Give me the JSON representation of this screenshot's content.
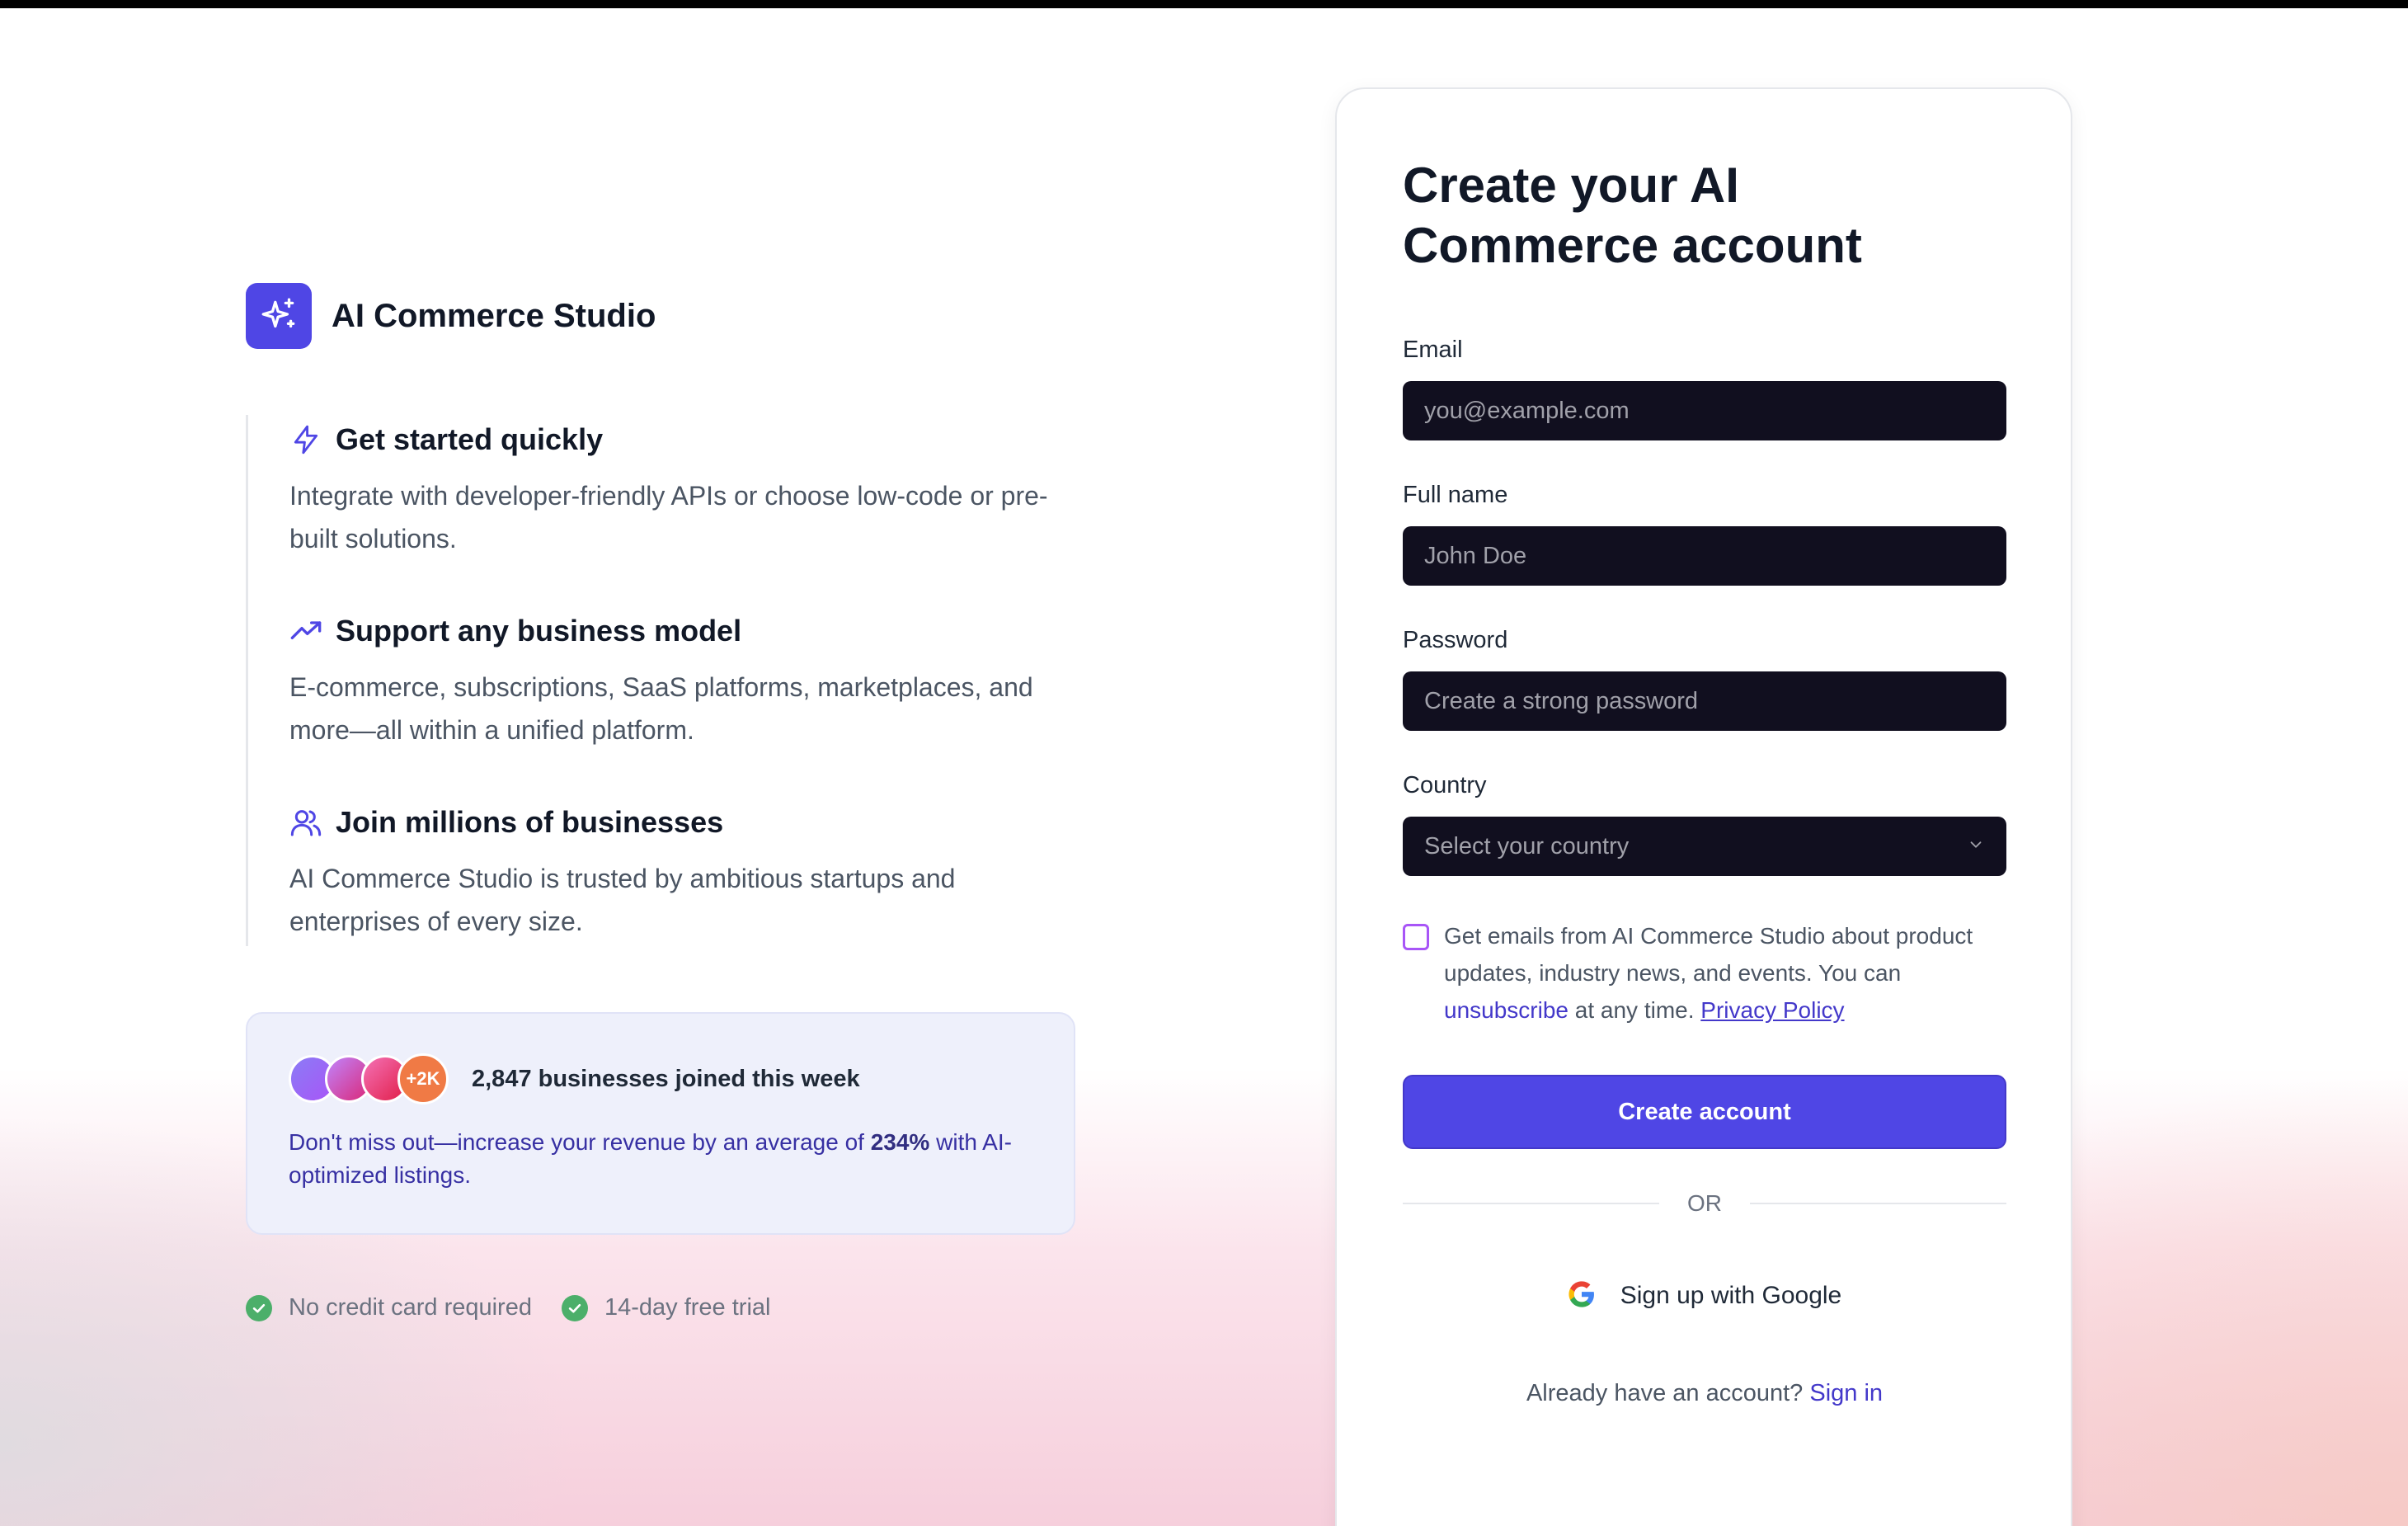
{
  "brand": {
    "name": "AI Commerce Studio",
    "logo_icon": "sparkles-icon",
    "color": "#4f46e5"
  },
  "features": [
    {
      "icon": "lightning-bolt-icon",
      "title": "Get started quickly",
      "description": "Integrate with developer-friendly APIs or choose low-code or pre-built solutions."
    },
    {
      "icon": "trending-up-icon",
      "title": "Support any business model",
      "description": "E-commerce, subscriptions, SaaS platforms, marketplaces, and more—all within a unified platform."
    },
    {
      "icon": "users-icon",
      "title": "Join millions of businesses",
      "description": "AI Commerce Studio is trusted by ambitious startups and enterprises of every size."
    }
  ],
  "promo": {
    "avatar_more": "+2K",
    "title": "2,847 businesses joined this week",
    "text_before": "Don't miss out—increase your revenue by an average of ",
    "highlight": "234%",
    "text_after": " with AI-optimized listings."
  },
  "checks": [
    "No credit card required",
    "14-day free trial"
  ],
  "signup": {
    "title": "Create your AI Commerce account",
    "email": {
      "label": "Email",
      "placeholder": "you@example.com",
      "value": ""
    },
    "full_name": {
      "label": "Full name",
      "placeholder": "John Doe",
      "value": ""
    },
    "password": {
      "label": "Password",
      "placeholder": "Create a strong password",
      "value": ""
    },
    "country": {
      "label": "Country",
      "selected": "Select your country"
    },
    "consent": {
      "checked": false,
      "text_before": "Get emails from AI Commerce Studio about product updates, industry news, and events. You can ",
      "unsubscribe_label": "unsubscribe",
      "text_middle": " at any time. ",
      "privacy_label": "Privacy Policy"
    },
    "submit_label": "Create account",
    "divider_label": "OR",
    "google_label": "Sign up with Google",
    "signin_prompt": "Already have an account?",
    "signin_label": "Sign in"
  },
  "colors": {
    "accent": "#4f46e5",
    "input_background": "#110f1f",
    "success": "#4caf6a"
  }
}
